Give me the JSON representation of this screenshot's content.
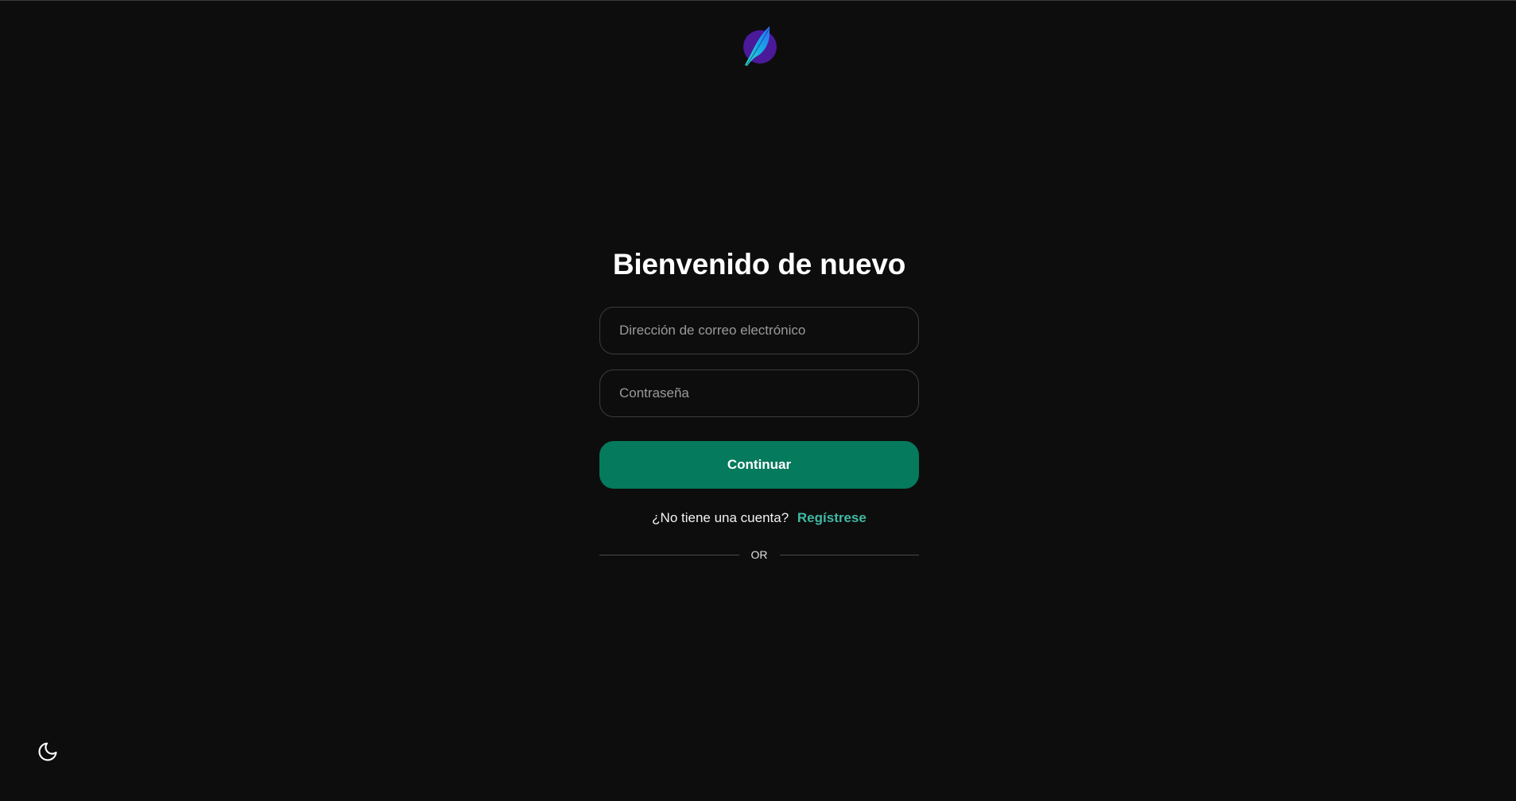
{
  "header": {
    "logo_icon": "feather-logo-icon"
  },
  "login": {
    "title": "Bienvenido de nuevo",
    "email_placeholder": "Dirección de correo electrónico",
    "email_value": "",
    "password_placeholder": "Contraseña",
    "password_value": "",
    "continue_label": "Continuar",
    "signup_prompt": "¿No tiene una cuenta?",
    "signup_link": "Regístrese",
    "divider_text": "OR"
  },
  "footer": {
    "theme_toggle_icon": "moon-icon"
  },
  "colors": {
    "background": "#0d0d0d",
    "primary_button": "#057a5c",
    "link": "#3fb9a3",
    "input_border": "#3c3c3c"
  }
}
